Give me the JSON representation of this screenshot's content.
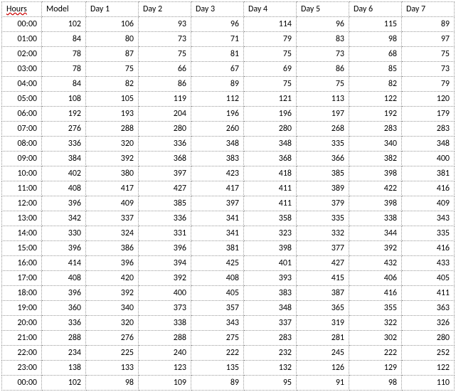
{
  "chart_data": {
    "type": "table",
    "headers": [
      "Hours",
      "Model",
      "Day 1",
      "Day 2",
      "Day 3",
      "Day 4",
      "Day 5",
      "Day 6",
      "Day 7"
    ],
    "rows": [
      [
        "00:00",
        102,
        106,
        93,
        96,
        114,
        96,
        115,
        89
      ],
      [
        "01:00",
        84,
        80,
        73,
        71,
        79,
        83,
        98,
        97
      ],
      [
        "02:00",
        78,
        87,
        75,
        81,
        75,
        73,
        68,
        75
      ],
      [
        "03:00",
        78,
        75,
        66,
        67,
        69,
        86,
        85,
        73
      ],
      [
        "04:00",
        84,
        82,
        86,
        89,
        75,
        75,
        82,
        79
      ],
      [
        "05:00",
        108,
        105,
        119,
        112,
        121,
        113,
        122,
        120
      ],
      [
        "06:00",
        192,
        193,
        204,
        196,
        196,
        197,
        192,
        179
      ],
      [
        "07:00",
        276,
        288,
        280,
        260,
        280,
        268,
        283,
        283
      ],
      [
        "08:00",
        336,
        320,
        336,
        348,
        348,
        335,
        340,
        348
      ],
      [
        "09:00",
        384,
        392,
        368,
        383,
        368,
        366,
        382,
        400
      ],
      [
        "10:00",
        402,
        380,
        397,
        423,
        418,
        385,
        398,
        381
      ],
      [
        "11:00",
        408,
        417,
        427,
        417,
        411,
        389,
        422,
        416
      ],
      [
        "12:00",
        396,
        409,
        385,
        397,
        411,
        379,
        398,
        409
      ],
      [
        "13:00",
        342,
        337,
        336,
        341,
        358,
        335,
        338,
        343
      ],
      [
        "14:00",
        330,
        324,
        331,
        341,
        323,
        332,
        344,
        335
      ],
      [
        "15:00",
        396,
        386,
        396,
        381,
        398,
        377,
        392,
        416
      ],
      [
        "16:00",
        414,
        396,
        394,
        425,
        401,
        427,
        432,
        433
      ],
      [
        "17:00",
        408,
        420,
        392,
        408,
        393,
        415,
        406,
        405
      ],
      [
        "18:00",
        396,
        392,
        400,
        405,
        383,
        387,
        416,
        411
      ],
      [
        "19:00",
        360,
        340,
        373,
        357,
        348,
        365,
        355,
        363
      ],
      [
        "20:00",
        336,
        320,
        338,
        343,
        337,
        319,
        322,
        326
      ],
      [
        "21:00",
        288,
        276,
        288,
        275,
        283,
        281,
        302,
        280
      ],
      [
        "22:00",
        234,
        225,
        240,
        222,
        232,
        245,
        222,
        252
      ],
      [
        "23:00",
        138,
        133,
        123,
        135,
        132,
        126,
        129,
        122
      ],
      [
        "00:00",
        102,
        98,
        109,
        89,
        95,
        91,
        98,
        110
      ]
    ]
  }
}
